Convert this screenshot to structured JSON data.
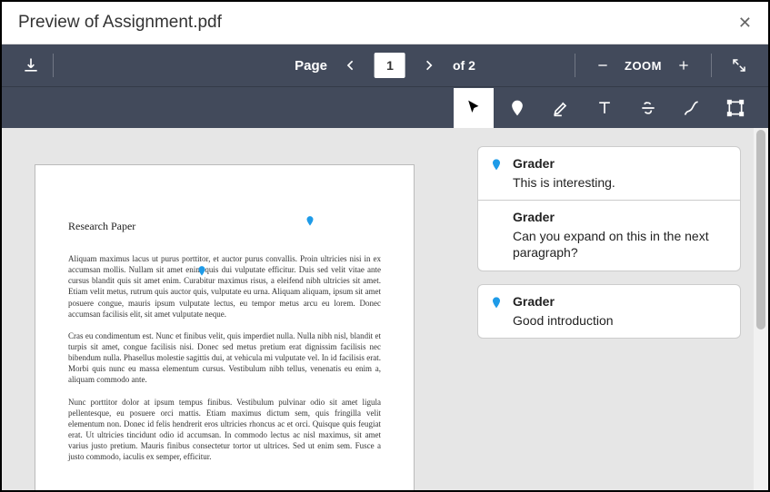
{
  "titlebar": {
    "title": "Preview of Assignment.pdf"
  },
  "toolbar": {
    "page_label": "Page",
    "page_current": "1",
    "page_total": "of 2",
    "zoom_label": "ZOOM"
  },
  "document": {
    "title": "Research Paper",
    "paragraphs": [
      "Aliquam maximus lacus ut purus porttitor, et auctor purus convallis. Proin ultricies nisi in ex accumsan mollis. Nullam sit amet enim quis dui vulputate efficitur. Duis sed velit vitae ante cursus blandit quis sit amet enim. Curabitur maximus risus, a eleifend nibh ultricies sit amet. Etiam velit metus, rutrum quis auctor quis, vulputate eu urna. Aliquam aliquam, ipsum sit amet posuere congue, mauris ipsum vulputate lectus, eu tempor metus arcu eu lorem. Donec accumsan facilisis elit, sit amet vulputate neque.",
      "Cras eu condimentum est. Nunc et finibus velit, quis imperdiet nulla. Nulla nibh nisl, blandit et turpis sit amet, congue facilisis nisi. Donec sed metus pretium erat dignissim facilisis nec bibendum nulla. Phasellus molestie sagittis dui, at vehicula mi vulputate vel. In id facilisis erat. Morbi quis nunc eu massa elementum cursus. Vestibulum nibh tellus, venenatis eu enim a, aliquam commodo ante.",
      "Nunc porttitor dolor at ipsum tempus finibus. Vestibulum pulvinar odio sit amet ligula pellentesque, eu posuere orci mattis. Etiam maximus dictum sem, quis fringilla velit elementum non. Donec id felis hendrerit eros ultricies rhoncus ac et orci. Quisque quis feugiat erat. Ut ultricies tincidunt odio id accumsan. In commodo lectus ac nisl maximus, sit amet varius justo pretium. Mauris finibus consectetur tortor ut ultrices. Sed ut enim sem. Fusce a justo commodo, iaculis ex semper, efficitur."
    ]
  },
  "comments": [
    {
      "author": "Grader",
      "text": "This is interesting."
    },
    {
      "author": "Grader",
      "text": "Can you expand on this in the next paragraph?"
    },
    {
      "author": "Grader",
      "text": "Good introduction"
    }
  ],
  "colors": {
    "pin": "#1E9BE8"
  }
}
